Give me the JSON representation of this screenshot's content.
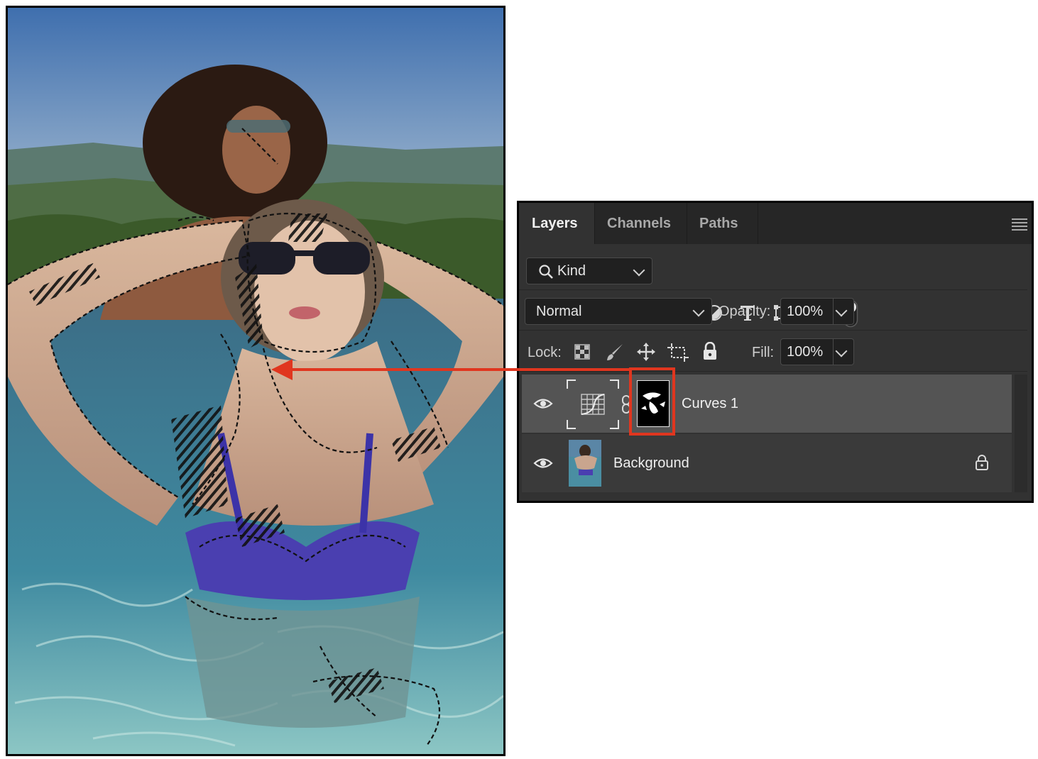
{
  "panel": {
    "tabs": [
      {
        "label": "Layers",
        "active": true
      },
      {
        "label": "Channels",
        "active": false
      },
      {
        "label": "Paths",
        "active": false
      }
    ],
    "filter": {
      "value": "Kind",
      "icons": [
        "image-filter-icon",
        "adjustment-filter-icon",
        "type-filter-icon",
        "shape-filter-icon",
        "smart-object-filter-icon",
        "filter-toggle-icon"
      ]
    },
    "blend_mode": "Normal",
    "opacity_label": "Opacity:",
    "opacity_value": "100%",
    "lock_label": "Lock:",
    "lock_icons": [
      "lock-transparent-pixels-icon",
      "lock-image-pixels-icon",
      "lock-position-icon",
      "lock-artboard-icon",
      "lock-all-icon"
    ],
    "fill_label": "Fill:",
    "fill_value": "100%",
    "layers": [
      {
        "name": "Curves 1",
        "type": "adjustment",
        "selected": true,
        "visible": true
      },
      {
        "name": "Background",
        "type": "image",
        "selected": false,
        "visible": true,
        "locked": true
      }
    ]
  },
  "colors": {
    "panel_bg": "#323232",
    "tab_bar_bg": "#262626",
    "selected_row": "#545454",
    "annotation_red": "#e0361f"
  }
}
